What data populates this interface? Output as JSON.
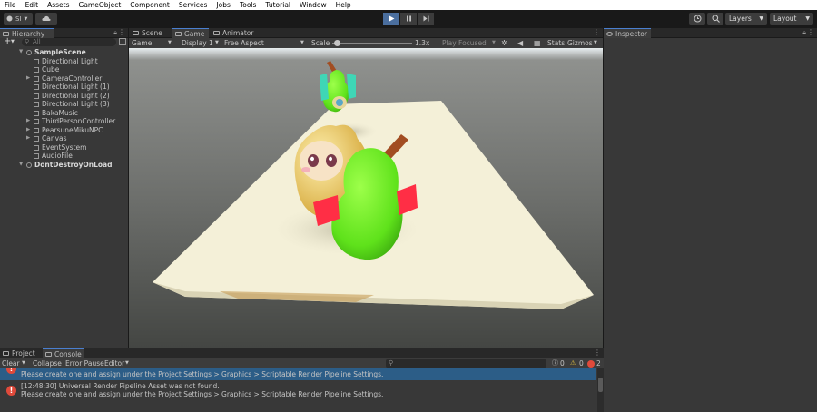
{
  "menu": [
    "File",
    "Edit",
    "Assets",
    "GameObject",
    "Component",
    "Services",
    "Jobs",
    "Tools",
    "Tutorial",
    "Window",
    "Help"
  ],
  "toolbar": {
    "account_label": "SI",
    "layers_label": "Layers",
    "layout_label": "Layout"
  },
  "hierarchy": {
    "tab_label": "Hierarchy",
    "search_placeholder": "All",
    "scene": "SampleScene",
    "items": [
      {
        "label": "Directional Light",
        "foldable": false
      },
      {
        "label": "Cube",
        "foldable": false
      },
      {
        "label": "CameraController",
        "foldable": true
      },
      {
        "label": "Directional Light (1)",
        "foldable": false
      },
      {
        "label": "Directional Light (2)",
        "foldable": false
      },
      {
        "label": "Directional Light (3)",
        "foldable": false
      },
      {
        "label": "BakaMusic",
        "foldable": false
      },
      {
        "label": "ThirdPersonController",
        "foldable": true
      },
      {
        "label": "PearsuneMikuNPC",
        "foldable": true
      },
      {
        "label": "Canvas",
        "foldable": true
      },
      {
        "label": "EventSystem",
        "foldable": false
      },
      {
        "label": "AudioFile",
        "foldable": false
      }
    ],
    "dont_destroy": "DontDestroyOnLoad"
  },
  "game_tabs": [
    "Scene",
    "Game",
    "Animator"
  ],
  "game_view": {
    "view_mode": "Game",
    "display": "Display 1",
    "aspect": "Free Aspect",
    "scale_label": "Scale",
    "scale_value": "1.3x",
    "play_focused": "Play Focused",
    "stats": "Stats",
    "gizmos": "Gizmos",
    "scale_fraction": 0.02
  },
  "inspector": {
    "tab_label": "Inspector"
  },
  "bottom_tabs": [
    "Project",
    "Console"
  ],
  "console": {
    "clear": "Clear",
    "collapse": "Collapse",
    "error_pause": "Error Pause",
    "editor": "Editor",
    "count_info": "0",
    "count_warn": "0",
    "count_error": "2",
    "entries": [
      {
        "line1": "",
        "line2": "Please create one and assign under the Project Settings > Graphics > Scriptable Render Pipeline Settings.",
        "selected": true
      },
      {
        "line1": "[12:48:30] Universal Render Pipeline Asset was not found.",
        "line2": "Please create one and assign under the Project Settings > Graphics > Scriptable Render Pipeline Settings.",
        "selected": false
      }
    ]
  },
  "colors": {
    "play_active": "#4a6e9e",
    "error_red": "#e04a3b",
    "selected_row": "#2c5d87"
  }
}
